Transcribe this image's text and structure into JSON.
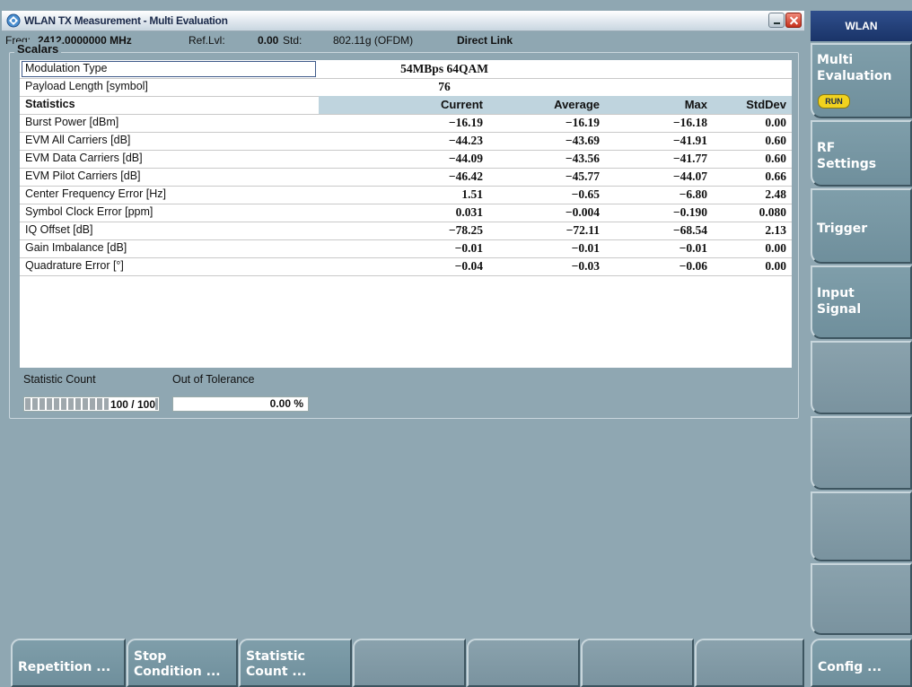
{
  "window": {
    "title": "WLAN TX Measurement  - Multi Evaluation"
  },
  "infobar": {
    "freq_label": "Freq:",
    "freq_value": "2412.0000000 MHz",
    "reflvl_label": "Ref.Lvl:",
    "reflvl_value": "0.00",
    "std_label": "Std:",
    "std_value": "802.11g (OFDM)",
    "link": "Direct Link"
  },
  "scalars": {
    "title": "Scalars",
    "modulation_label": "Modulation Type",
    "modulation_value": "54MBps 64QAM",
    "payload_label": "Payload Length [symbol]",
    "payload_value": "76",
    "statistics_label": "Statistics",
    "headers": [
      "Current",
      "Average",
      "Max",
      "StdDev"
    ],
    "rows": [
      {
        "label": "Burst Power [dBm]",
        "current": "−16.19",
        "average": "−16.19",
        "max": "−16.18",
        "stddev": "0.00"
      },
      {
        "label": "EVM All Carriers [dB]",
        "current": "−44.23",
        "average": "−43.69",
        "max": "−41.91",
        "stddev": "0.60"
      },
      {
        "label": "EVM Data Carriers [dB]",
        "current": "−44.09",
        "average": "−43.56",
        "max": "−41.77",
        "stddev": "0.60"
      },
      {
        "label": "EVM Pilot Carriers [dB]",
        "current": "−46.42",
        "average": "−45.77",
        "max": "−44.07",
        "stddev": "0.66"
      },
      {
        "label": "Center Frequency Error [Hz]",
        "current": "1.51",
        "average": "−0.65",
        "max": "−6.80",
        "stddev": "2.48"
      },
      {
        "label": "Symbol Clock Error [ppm]",
        "current": "0.031",
        "average": "−0.004",
        "max": "−0.190",
        "stddev": "0.080"
      },
      {
        "label": "IQ Offset [dB]",
        "current": "−78.25",
        "average": "−72.11",
        "max": "−68.54",
        "stddev": "2.13"
      },
      {
        "label": "Gain Imbalance [dB]",
        "current": "−0.01",
        "average": "−0.01",
        "max": "−0.01",
        "stddev": "0.00"
      },
      {
        "label": "Quadrature Error [°]",
        "current": "−0.04",
        "average": "−0.03",
        "max": "−0.06",
        "stddev": "0.00"
      }
    ]
  },
  "statistic_count": {
    "label": "Statistic Count",
    "value": "100 / 100",
    "progress": 1.0
  },
  "out_of_tolerance": {
    "label": "Out of Tolerance",
    "value": "0.00 %"
  },
  "side_panel": {
    "header": "WLAN",
    "keys": [
      {
        "label": "Multi\nEvaluation",
        "badge": "RUN"
      },
      {
        "label": "RF\nSettings"
      },
      {
        "label": "Trigger"
      },
      {
        "label": "Input\nSignal"
      },
      {
        "label": ""
      },
      {
        "label": ""
      },
      {
        "label": ""
      },
      {
        "label": ""
      }
    ],
    "config": "Config ..."
  },
  "bottom_keys": [
    {
      "label": "Repetition ..."
    },
    {
      "label": "Stop\nCondition ..."
    },
    {
      "label": "Statistic\nCount ..."
    },
    {
      "label": ""
    },
    {
      "label": ""
    },
    {
      "label": ""
    },
    {
      "label": ""
    }
  ],
  "colors": {
    "background": "#8fa7b2",
    "header_blue": "#1a3468",
    "run_badge": "#f1d21e",
    "stats_header": "#bfd4de"
  }
}
